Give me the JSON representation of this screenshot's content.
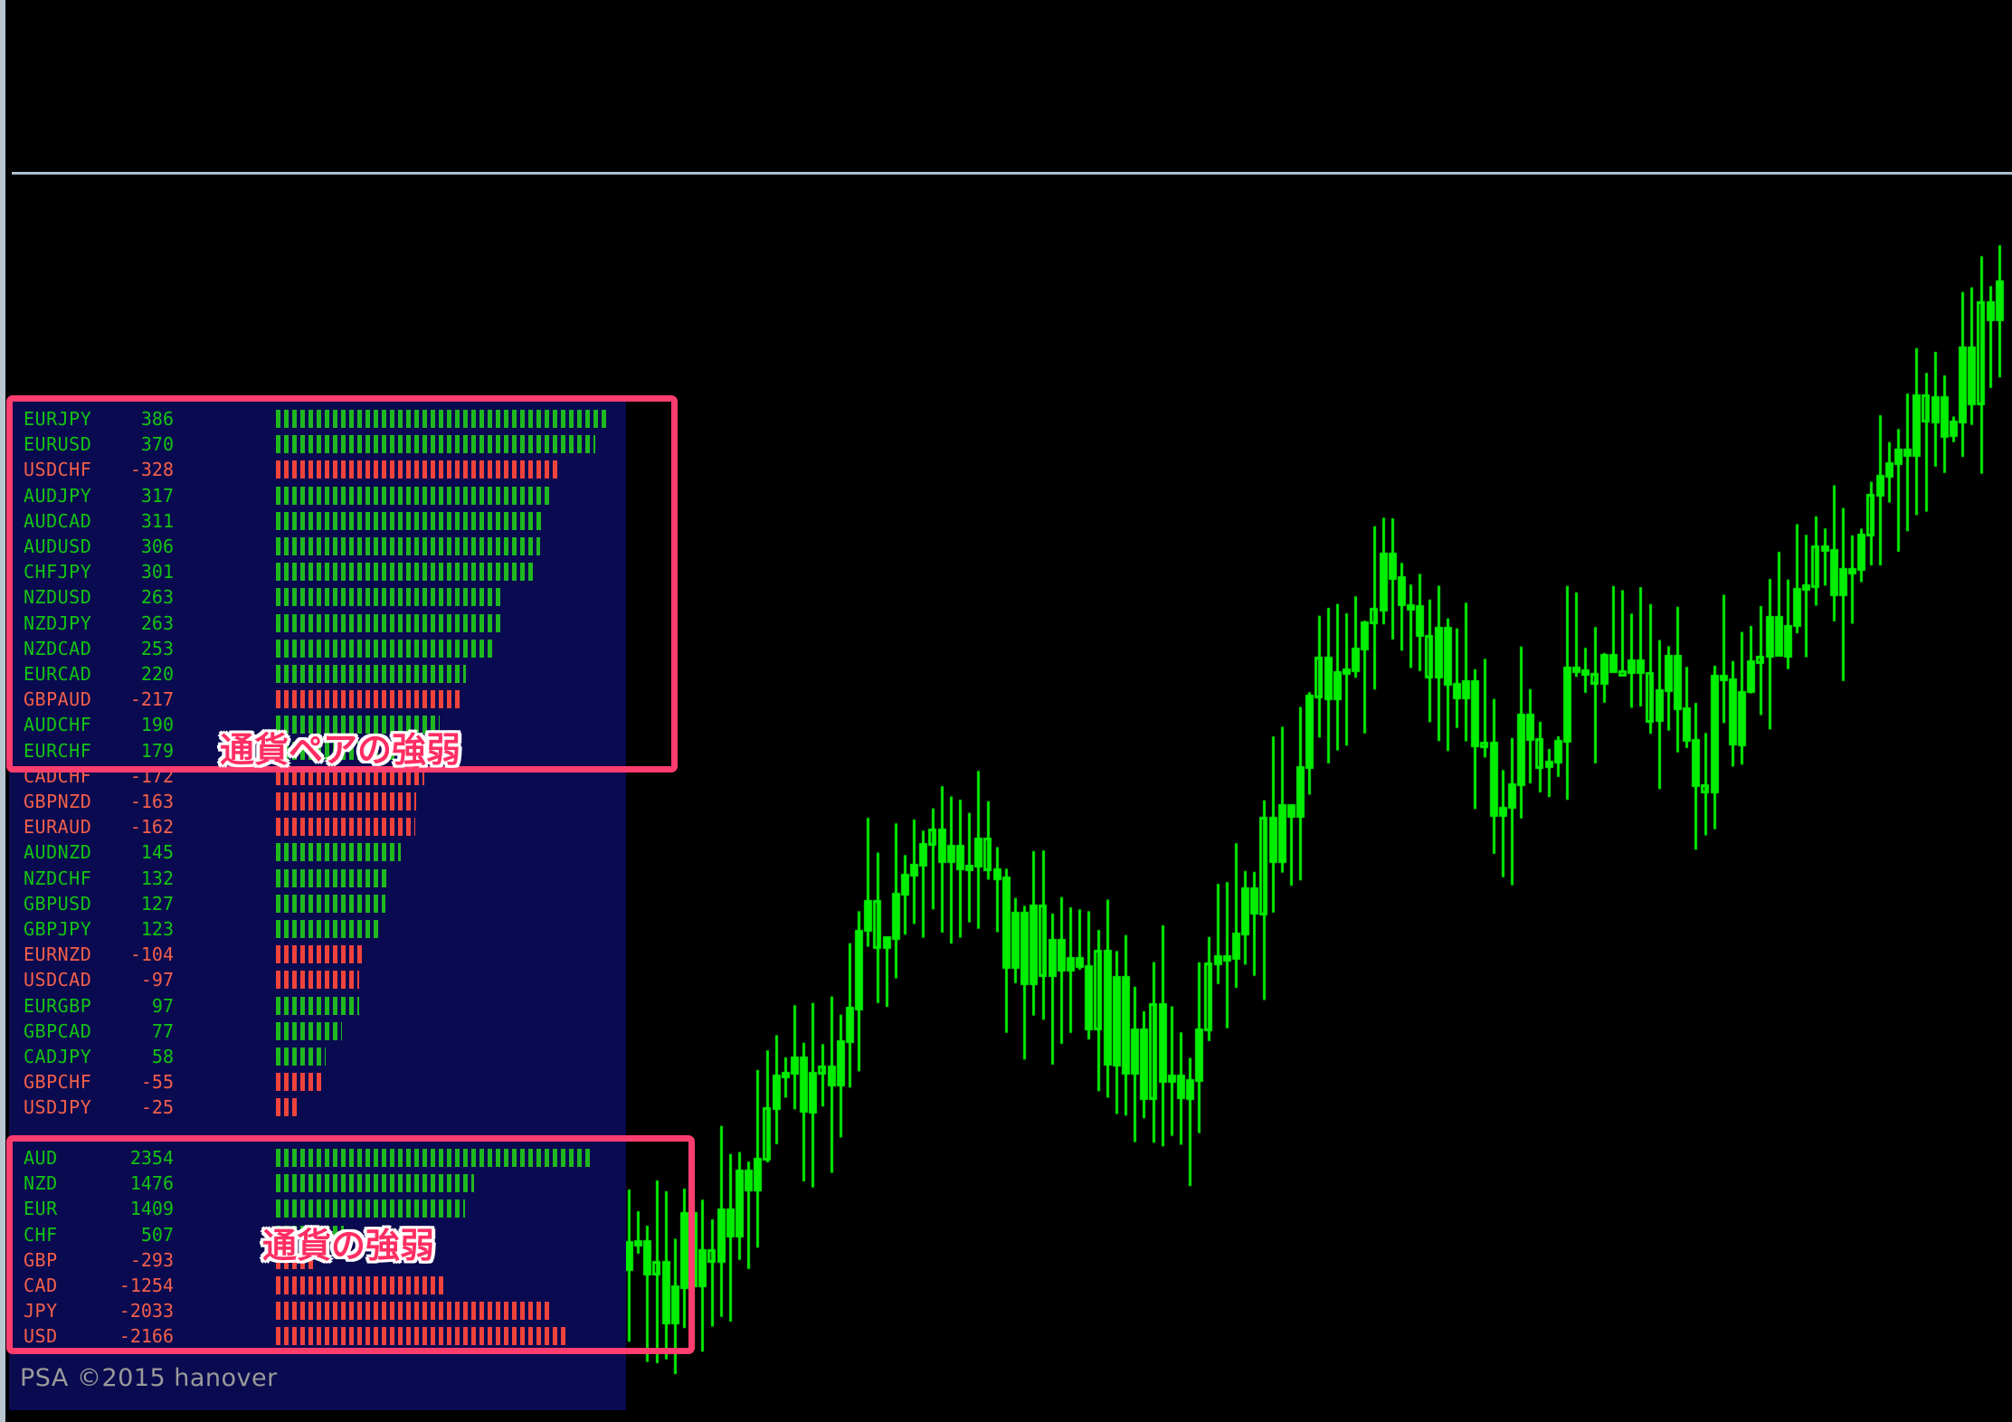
{
  "app": {
    "watermark": "PSA ©2015 hanover"
  },
  "annotations": [
    {
      "id": "pair-strength",
      "text": "通貨ペアの強弱",
      "color": "#ff2e63"
    },
    {
      "id": "currency-strength",
      "text": "通貨の強弱",
      "color": "#ff2e63"
    }
  ],
  "colors": {
    "panel_bg": "#0a0a50",
    "positive": "#13c413",
    "negative": "#f4604a",
    "bar_positive": "#1fb81f",
    "bar_negative": "#f0433c",
    "annotation": "#ff3d6e",
    "candle": "#00ee00",
    "chart_bg": "#000000",
    "separator": "#aebecb"
  },
  "chart_data": {
    "type": "bar",
    "title": "通貨ペアの強弱 / 通貨の強弱",
    "xlabel": "",
    "ylabel": "",
    "panels": [
      {
        "id": "pair-strength",
        "label": "通貨ペアの強弱",
        "categories": [
          "EURJPY",
          "EURUSD",
          "USDCHF",
          "AUDJPY",
          "AUDCAD",
          "AUDUSD",
          "CHFJPY",
          "NZDUSD",
          "NZDJPY",
          "NZDCAD",
          "EURCAD",
          "GBPAUD",
          "AUDCHF",
          "EURCHF",
          "CADCHF",
          "GBPNZD",
          "EURAUD",
          "AUDNZD",
          "NZDCHF",
          "GBPUSD",
          "GBPJPY",
          "EURNZD",
          "USDCAD",
          "EURGBP",
          "GBPCAD",
          "CADJPY",
          "GBPCHF",
          "USDJPY"
        ],
        "values": [
          386,
          370,
          -328,
          317,
          311,
          306,
          301,
          263,
          263,
          253,
          220,
          -217,
          190,
          179,
          -172,
          -163,
          -162,
          145,
          132,
          127,
          123,
          -104,
          -97,
          97,
          77,
          58,
          -55,
          -25
        ],
        "max_abs": 386
      },
      {
        "id": "currency-strength",
        "label": "通貨の強弱",
        "categories": [
          "AUD",
          "NZD",
          "EUR",
          "CHF",
          "GBP",
          "CAD",
          "JPY",
          "USD"
        ],
        "values": [
          2354,
          1476,
          1409,
          507,
          -293,
          -1254,
          -2033,
          -2166
        ],
        "max_abs": 2354
      }
    ]
  },
  "price_chart": {
    "type": "candlestick",
    "series_color": "#00ee00",
    "background": "#000000"
  }
}
